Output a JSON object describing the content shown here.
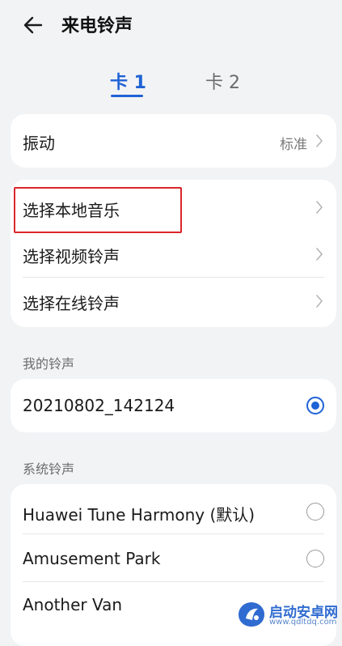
{
  "header": {
    "title": "来电铃声",
    "back_icon": "arrow-left-icon"
  },
  "tabs": [
    {
      "label": "卡 1",
      "selected": true
    },
    {
      "label": "卡 2",
      "selected": false
    }
  ],
  "vibration": {
    "label": "振动",
    "value": "标准"
  },
  "sources": [
    {
      "label": "选择本地音乐"
    },
    {
      "label": "选择视频铃声"
    },
    {
      "label": "选择在线铃声"
    }
  ],
  "my_ringtones": {
    "section_title": "我的铃声",
    "items": [
      {
        "label": "20210802_142124",
        "selected": true
      }
    ]
  },
  "system_ringtones": {
    "section_title": "系统铃声",
    "items": [
      {
        "label": "Huawei Tune Harmony (默认)",
        "selected": false
      },
      {
        "label": "Amusement Park",
        "selected": false
      },
      {
        "label": "Another Van",
        "selected": false
      }
    ]
  },
  "watermark": {
    "name": "启动安卓网",
    "url": "www.qdltdq.com"
  },
  "colors": {
    "accent": "#1f62d6",
    "highlight": "#d9262c",
    "background": "#f1f3f5"
  }
}
